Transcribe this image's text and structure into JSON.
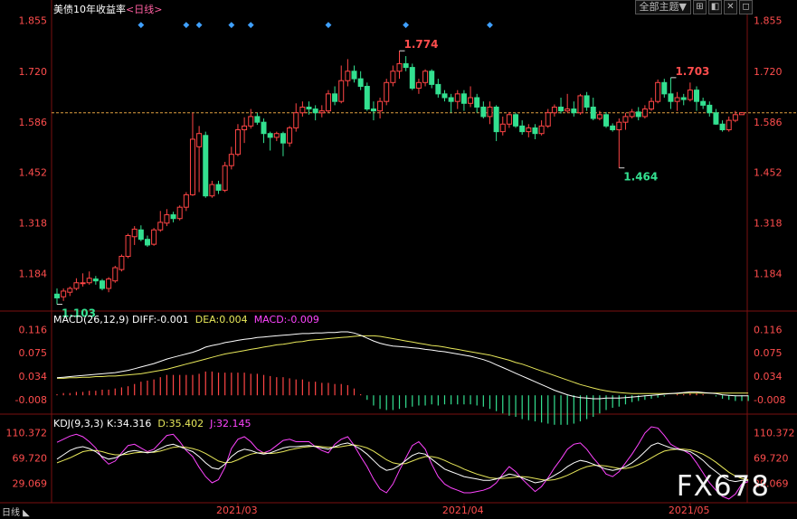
{
  "title": "美债10年收益率",
  "period_label": "<日线>",
  "toolbar": {
    "theme_label": "全部主题▼",
    "btn1": "⊞",
    "btn2": "◧",
    "btn3": "✕",
    "btn4": "◻"
  },
  "bottom_period": "日线 ◣",
  "watermark": "FX678",
  "colors": {
    "up": "#ff4545",
    "down": "#33e090",
    "price_axis": "#ff4d4d",
    "diff": "#ffffff",
    "dea": "#e8e85a",
    "macd": "#ff44ff",
    "k": "#ffffff",
    "d": "#e8e85a",
    "j": "#ff44ff",
    "ref_line": "#e0a040"
  },
  "chart_data": {
    "type": "candlestick",
    "x_ticks": [
      "2021/03",
      "2021/04",
      "2021/05"
    ],
    "price": {
      "yticks": [
        1.855,
        1.72,
        1.586,
        1.452,
        1.318,
        1.184
      ],
      "ylim": [
        1.09,
        1.875
      ],
      "annotations": [
        {
          "label": "1.774",
          "value": 1.774,
          "index": 53,
          "kind": "high"
        },
        {
          "label": "1.703",
          "value": 1.703,
          "index": 95,
          "kind": "high"
        },
        {
          "label": "1.464",
          "value": 1.464,
          "index": 87,
          "kind": "low"
        },
        {
          "label": "1.103",
          "value": 1.103,
          "index": 0,
          "kind": "low"
        }
      ],
      "reference_line": 1.61,
      "marker_indices": [
        13,
        20,
        22,
        27,
        30,
        42,
        54,
        67
      ],
      "candles": [
        [
          1.13,
          1.12,
          1.145,
          1.103
        ],
        [
          1.123,
          1.138,
          1.145,
          1.112
        ],
        [
          1.135,
          1.145,
          1.15,
          1.125
        ],
        [
          1.145,
          1.16,
          1.172,
          1.14
        ],
        [
          1.158,
          1.16,
          1.185,
          1.15
        ],
        [
          1.16,
          1.172,
          1.19,
          1.155
        ],
        [
          1.17,
          1.165,
          1.178,
          1.155
        ],
        [
          1.165,
          1.145,
          1.17,
          1.14
        ],
        [
          1.145,
          1.17,
          1.175,
          1.135
        ],
        [
          1.165,
          1.2,
          1.205,
          1.16
        ],
        [
          1.195,
          1.23,
          1.235,
          1.19
        ],
        [
          1.23,
          1.285,
          1.29,
          1.225
        ],
        [
          1.282,
          1.302,
          1.31,
          1.26
        ],
        [
          1.3,
          1.275,
          1.312,
          1.27
        ],
        [
          1.275,
          1.26,
          1.285,
          1.255
        ],
        [
          1.262,
          1.3,
          1.305,
          1.258
        ],
        [
          1.3,
          1.32,
          1.35,
          1.295
        ],
        [
          1.318,
          1.34,
          1.355,
          1.31
        ],
        [
          1.34,
          1.33,
          1.348,
          1.32
        ],
        [
          1.33,
          1.36,
          1.365,
          1.325
        ],
        [
          1.36,
          1.393,
          1.4,
          1.35
        ],
        [
          1.393,
          1.54,
          1.61,
          1.39
        ],
        [
          1.52,
          1.555,
          1.575,
          1.4
        ],
        [
          1.55,
          1.39,
          1.56,
          1.385
        ],
        [
          1.39,
          1.42,
          1.43,
          1.385
        ],
        [
          1.42,
          1.405,
          1.43,
          1.395
        ],
        [
          1.405,
          1.47,
          1.48,
          1.4
        ],
        [
          1.47,
          1.5,
          1.52,
          1.46
        ],
        [
          1.5,
          1.565,
          1.58,
          1.495
        ],
        [
          1.565,
          1.575,
          1.598,
          1.53
        ],
        [
          1.575,
          1.6,
          1.62,
          1.568
        ],
        [
          1.6,
          1.585,
          1.61,
          1.578
        ],
        [
          1.585,
          1.555,
          1.595,
          1.53
        ],
        [
          1.555,
          1.545,
          1.56,
          1.51
        ],
        [
          1.545,
          1.555,
          1.56,
          1.535
        ],
        [
          1.555,
          1.53,
          1.56,
          1.495
        ],
        [
          1.53,
          1.57,
          1.575,
          1.52
        ],
        [
          1.57,
          1.61,
          1.635,
          1.56
        ],
        [
          1.61,
          1.625,
          1.64,
          1.6
        ],
        [
          1.625,
          1.62,
          1.64,
          1.605
        ],
        [
          1.62,
          1.61,
          1.63,
          1.59
        ],
        [
          1.61,
          1.615,
          1.63,
          1.598
        ],
        [
          1.615,
          1.66,
          1.67,
          1.61
        ],
        [
          1.66,
          1.64,
          1.68,
          1.63
        ],
        [
          1.64,
          1.695,
          1.735,
          1.635
        ],
        [
          1.695,
          1.72,
          1.752,
          1.68
        ],
        [
          1.72,
          1.7,
          1.735,
          1.69
        ],
        [
          1.7,
          1.68,
          1.72,
          1.67
        ],
        [
          1.68,
          1.62,
          1.69,
          1.615
        ],
        [
          1.62,
          1.615,
          1.64,
          1.59
        ],
        [
          1.615,
          1.64,
          1.65,
          1.595
        ],
        [
          1.64,
          1.69,
          1.7,
          1.63
        ],
        [
          1.69,
          1.72,
          1.735,
          1.68
        ],
        [
          1.72,
          1.74,
          1.774,
          1.7
        ],
        [
          1.74,
          1.73,
          1.76,
          1.72
        ],
        [
          1.73,
          1.675,
          1.74,
          1.67
        ],
        [
          1.675,
          1.69,
          1.7,
          1.66
        ],
        [
          1.69,
          1.72,
          1.725,
          1.68
        ],
        [
          1.72,
          1.685,
          1.725,
          1.675
        ],
        [
          1.685,
          1.66,
          1.7,
          1.65
        ],
        [
          1.66,
          1.65,
          1.67,
          1.64
        ],
        [
          1.65,
          1.64,
          1.66,
          1.61
        ],
        [
          1.64,
          1.66,
          1.67,
          1.62
        ],
        [
          1.66,
          1.635,
          1.67,
          1.615
        ],
        [
          1.635,
          1.65,
          1.68,
          1.625
        ],
        [
          1.65,
          1.625,
          1.66,
          1.61
        ],
        [
          1.625,
          1.6,
          1.64,
          1.595
        ],
        [
          1.6,
          1.625,
          1.64,
          1.58
        ],
        [
          1.625,
          1.56,
          1.63,
          1.535
        ],
        [
          1.56,
          1.58,
          1.6,
          1.55
        ],
        [
          1.58,
          1.605,
          1.612,
          1.57
        ],
        [
          1.605,
          1.575,
          1.61,
          1.57
        ],
        [
          1.575,
          1.56,
          1.59,
          1.552
        ],
        [
          1.56,
          1.57,
          1.58,
          1.545
        ],
        [
          1.57,
          1.555,
          1.58,
          1.54
        ],
        [
          1.555,
          1.575,
          1.59,
          1.55
        ],
        [
          1.575,
          1.61,
          1.62,
          1.57
        ],
        [
          1.61,
          1.625,
          1.632,
          1.6
        ],
        [
          1.625,
          1.615,
          1.65,
          1.608
        ],
        [
          1.615,
          1.62,
          1.66,
          1.61
        ],
        [
          1.62,
          1.61,
          1.64,
          1.6
        ],
        [
          1.61,
          1.655,
          1.66,
          1.605
        ],
        [
          1.655,
          1.625,
          1.665,
          1.615
        ],
        [
          1.625,
          1.595,
          1.65,
          1.59
        ],
        [
          1.595,
          1.605,
          1.615,
          1.59
        ],
        [
          1.605,
          1.575,
          1.612,
          1.57
        ],
        [
          1.575,
          1.565,
          1.582,
          1.56
        ],
        [
          1.565,
          1.585,
          1.595,
          1.464
        ],
        [
          1.585,
          1.6,
          1.61,
          1.565
        ],
        [
          1.6,
          1.612,
          1.62,
          1.595
        ],
        [
          1.612,
          1.6,
          1.625,
          1.59
        ],
        [
          1.6,
          1.62,
          1.63,
          1.595
        ],
        [
          1.62,
          1.64,
          1.65,
          1.615
        ],
        [
          1.64,
          1.69,
          1.698,
          1.635
        ],
        [
          1.69,
          1.66,
          1.7,
          1.65
        ],
        [
          1.66,
          1.64,
          1.703,
          1.62
        ],
        [
          1.64,
          1.65,
          1.665,
          1.615
        ],
        [
          1.65,
          1.645,
          1.66,
          1.63
        ],
        [
          1.645,
          1.67,
          1.69,
          1.64
        ],
        [
          1.67,
          1.64,
          1.68,
          1.615
        ],
        [
          1.64,
          1.63,
          1.65,
          1.62
        ],
        [
          1.63,
          1.61,
          1.64,
          1.6
        ],
        [
          1.61,
          1.58,
          1.62,
          1.578
        ],
        [
          1.58,
          1.565,
          1.59,
          1.56
        ],
        [
          1.565,
          1.59,
          1.6,
          1.56
        ],
        [
          1.59,
          1.605,
          1.615,
          1.585
        ],
        [
          1.605,
          1.61,
          1.612,
          1.605
        ]
      ]
    },
    "macd": {
      "label": "MACD(26,12,9)",
      "diff_label": "DIFF:-0.001",
      "dea_label": "DEA:0.004",
      "macd_label": "MACD:-0.009",
      "yticks": [
        0.116,
        0.075,
        0.034,
        -0.008
      ],
      "ylim": [
        -0.03,
        0.128
      ],
      "diff": [
        0.031,
        0.032,
        0.033,
        0.034,
        0.035,
        0.036,
        0.037,
        0.038,
        0.039,
        0.04,
        0.042,
        0.044,
        0.047,
        0.05,
        0.053,
        0.056,
        0.06,
        0.064,
        0.067,
        0.07,
        0.073,
        0.076,
        0.08,
        0.085,
        0.088,
        0.09,
        0.093,
        0.095,
        0.097,
        0.099,
        0.1,
        0.102,
        0.103,
        0.104,
        0.105,
        0.106,
        0.107,
        0.108,
        0.109,
        0.109,
        0.11,
        0.11,
        0.111,
        0.111,
        0.112,
        0.112,
        0.11,
        0.106,
        0.101,
        0.096,
        0.092,
        0.089,
        0.087,
        0.086,
        0.085,
        0.084,
        0.083,
        0.081,
        0.08,
        0.078,
        0.077,
        0.075,
        0.073,
        0.071,
        0.069,
        0.066,
        0.063,
        0.059,
        0.054,
        0.049,
        0.044,
        0.039,
        0.034,
        0.029,
        0.024,
        0.019,
        0.014,
        0.009,
        0.005,
        0.001,
        -0.002,
        -0.004,
        -0.005,
        -0.006,
        -0.006,
        -0.005,
        -0.005,
        -0.005,
        -0.004,
        -0.003,
        -0.002,
        -0.001,
        0.0,
        0.001,
        0.002,
        0.003,
        0.004,
        0.005,
        0.006,
        0.006,
        0.005,
        0.004,
        0.003,
        0.001,
        0.0,
        -0.001,
        -0.001,
        -0.001
      ],
      "dea": [
        0.03,
        0.03,
        0.031,
        0.031,
        0.032,
        0.032,
        0.033,
        0.033,
        0.034,
        0.034,
        0.035,
        0.036,
        0.037,
        0.038,
        0.04,
        0.042,
        0.044,
        0.046,
        0.049,
        0.052,
        0.055,
        0.058,
        0.061,
        0.064,
        0.067,
        0.07,
        0.073,
        0.075,
        0.077,
        0.079,
        0.081,
        0.083,
        0.085,
        0.087,
        0.089,
        0.09,
        0.092,
        0.094,
        0.095,
        0.097,
        0.098,
        0.099,
        0.1,
        0.101,
        0.102,
        0.103,
        0.104,
        0.105,
        0.105,
        0.105,
        0.104,
        0.102,
        0.1,
        0.098,
        0.096,
        0.094,
        0.092,
        0.09,
        0.088,
        0.087,
        0.085,
        0.083,
        0.081,
        0.079,
        0.077,
        0.075,
        0.073,
        0.071,
        0.068,
        0.065,
        0.062,
        0.058,
        0.055,
        0.051,
        0.047,
        0.043,
        0.039,
        0.035,
        0.031,
        0.027,
        0.023,
        0.019,
        0.016,
        0.013,
        0.01,
        0.008,
        0.006,
        0.005,
        0.004,
        0.003,
        0.003,
        0.003,
        0.003,
        0.003,
        0.003,
        0.003,
        0.003,
        0.004,
        0.004,
        0.004,
        0.004,
        0.004,
        0.004,
        0.004,
        0.004,
        0.004,
        0.004,
        0.004
      ]
    },
    "kdj": {
      "label": "KDJ(9,3,3)",
      "k_label": "K:34.316",
      "d_label": "D:35.402",
      "j_label": "J:32.145",
      "yticks": [
        110.372,
        69.72,
        29.069
      ],
      "ylim": [
        -2,
        120
      ],
      "k": [
        68,
        75,
        82,
        86,
        88,
        85,
        80,
        72,
        68,
        70,
        75,
        80,
        82,
        80,
        78,
        80,
        85,
        90,
        92,
        88,
        84,
        80,
        72,
        62,
        54,
        52,
        60,
        72,
        80,
        84,
        82,
        78,
        76,
        78,
        82,
        86,
        88,
        88,
        89,
        90,
        88,
        86,
        84,
        88,
        92,
        94,
        90,
        84,
        76,
        66,
        56,
        50,
        52,
        58,
        66,
        74,
        78,
        76,
        68,
        60,
        52,
        48,
        44,
        40,
        38,
        36,
        34,
        34,
        36,
        40,
        44,
        42,
        38,
        34,
        30,
        32,
        36,
        42,
        48,
        56,
        62,
        66,
        64,
        60,
        56,
        52,
        50,
        52,
        56,
        62,
        70,
        80,
        90,
        94,
        90,
        86,
        84,
        82,
        80,
        74,
        66,
        56,
        48,
        40,
        34,
        32,
        34,
        34
      ],
      "d": [
        62,
        66,
        70,
        75,
        80,
        82,
        82,
        80,
        77,
        75,
        75,
        76,
        78,
        79,
        79,
        79,
        81,
        84,
        87,
        88,
        87,
        85,
        82,
        77,
        71,
        65,
        62,
        63,
        67,
        72,
        76,
        78,
        78,
        77,
        78,
        80,
        83,
        85,
        87,
        88,
        89,
        88,
        87,
        87,
        88,
        90,
        91,
        89,
        86,
        81,
        74,
        67,
        62,
        60,
        61,
        65,
        69,
        72,
        72,
        70,
        66,
        61,
        57,
        52,
        48,
        44,
        41,
        38,
        37,
        37,
        38,
        39,
        40,
        39,
        37,
        35,
        34,
        35,
        38,
        42,
        47,
        52,
        56,
        58,
        58,
        57,
        55,
        53,
        53,
        55,
        59,
        64,
        70,
        76,
        81,
        83,
        84,
        84,
        83,
        80,
        76,
        70,
        63,
        55,
        47,
        41,
        37,
        35
      ],
      "j": [
        95,
        100,
        105,
        108,
        104,
        96,
        86,
        70,
        60,
        65,
        78,
        90,
        92,
        86,
        80,
        84,
        95,
        106,
        108,
        96,
        82,
        72,
        55,
        40,
        30,
        35,
        55,
        85,
        100,
        104,
        96,
        84,
        78,
        82,
        90,
        98,
        100,
        96,
        96,
        96,
        88,
        82,
        78,
        92,
        100,
        104,
        90,
        72,
        56,
        36,
        20,
        14,
        28,
        50,
        70,
        90,
        96,
        84,
        60,
        40,
        28,
        22,
        18,
        14,
        14,
        16,
        18,
        22,
        30,
        44,
        56,
        48,
        36,
        26,
        16,
        24,
        38,
        54,
        68,
        84,
        92,
        94,
        84,
        70,
        58,
        44,
        40,
        48,
        62,
        76,
        92,
        110,
        120,
        118,
        106,
        92,
        86,
        82,
        76,
        62,
        46,
        30,
        18,
        8,
        4,
        12,
        28,
        32
      ]
    }
  }
}
